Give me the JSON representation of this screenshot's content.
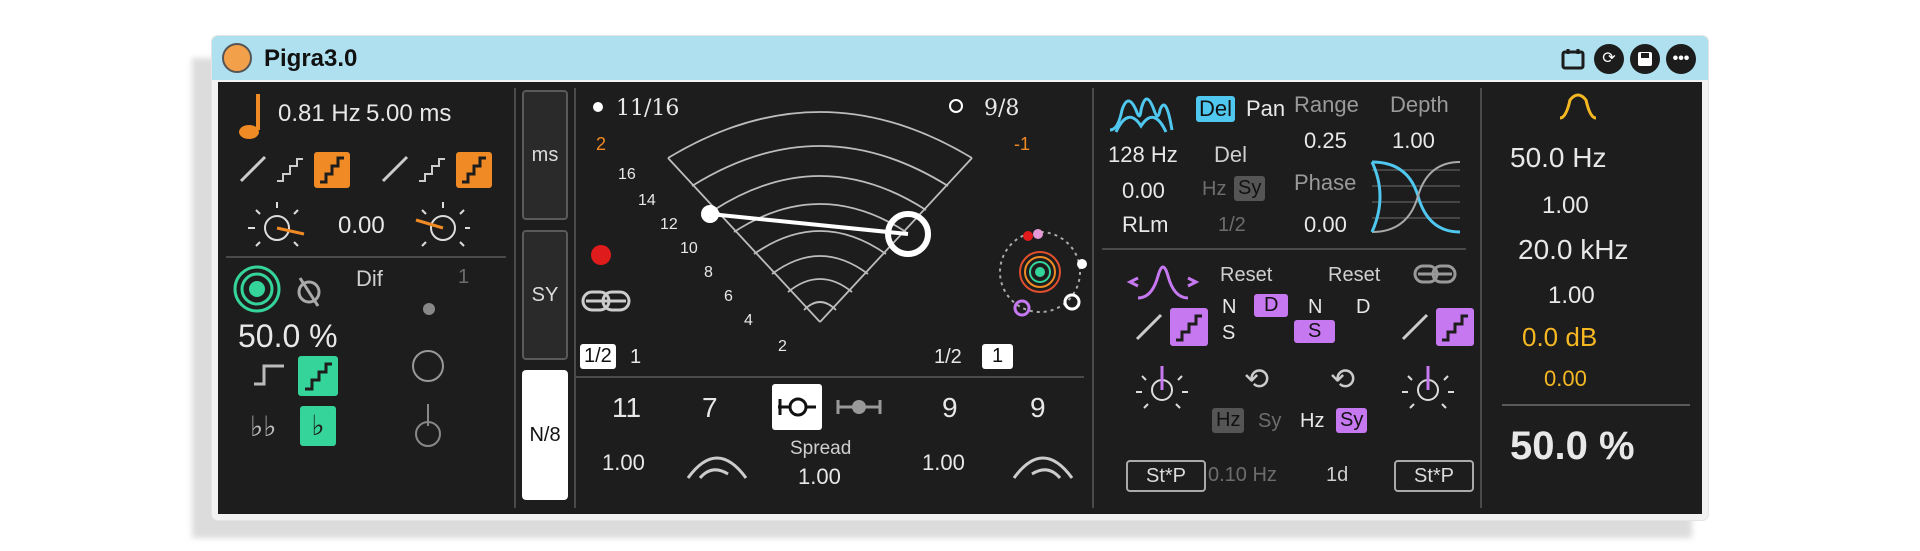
{
  "window": {
    "title": "Pigra3.0"
  },
  "colors": {
    "orange": "#f08a24",
    "green": "#35d49a",
    "purple": "#c678f0",
    "cyan": "#4fc7ef",
    "yellow": "#f5b823",
    "panel": "#1d1d1d"
  },
  "left": {
    "rate_hz": "0.81 Hz",
    "rate_ms": "5.00 ms",
    "offset": "0.00",
    "dif_label": "Dif",
    "dif_value": "1",
    "percent": "50.0 %"
  },
  "modes": {
    "ms": "ms",
    "sy": "SY",
    "n8": "N/8"
  },
  "center": {
    "left_ratio": "11/16",
    "right_ratio": "9/8",
    "left_top_num": "2",
    "right_top_num": "-1",
    "scale": [
      "16",
      "14",
      "12",
      "10",
      "8",
      "6",
      "4",
      "2"
    ],
    "left_half": "1/2",
    "left_one": "1",
    "right_half": "1/2",
    "right_one": "1",
    "val_11": "11",
    "val_7": "7",
    "val_9a": "9",
    "val_9b": "9",
    "left_amt": "1.00",
    "right_amt": "1.00",
    "spread_label": "Spread",
    "spread_value": "1.00"
  },
  "right": {
    "del_label": "Del",
    "pan_label": "Pan",
    "freq": "128 Hz",
    "val": "0.00",
    "rlm": "RLm",
    "del2": "Del",
    "hz": "Hz",
    "sy": "Sy",
    "half": "1/2",
    "range_label": "Range",
    "range_value": "0.25",
    "depth_label": "Depth",
    "depth_value": "1.00",
    "phase_label": "Phase",
    "phase_value": "0.00",
    "reset1": "Reset",
    "reset2": "Reset",
    "n1": "N",
    "d1": "D",
    "s1": "S",
    "n2": "N",
    "d2": "D",
    "s2": "S",
    "hz1": "Hz",
    "sy1": "Sy",
    "hz2": "Hz",
    "sy2": "Sy",
    "rate1": "0.10 Hz",
    "rate2": "1d",
    "stp1": "St*P",
    "stp2": "St*P"
  },
  "filter": {
    "freq1": "50.0 Hz",
    "q1": "1.00",
    "freq2": "20.0 kHz",
    "q2": "1.00",
    "gain": "0.0 dB",
    "gain2": "0.00",
    "mix": "50.0 %"
  }
}
